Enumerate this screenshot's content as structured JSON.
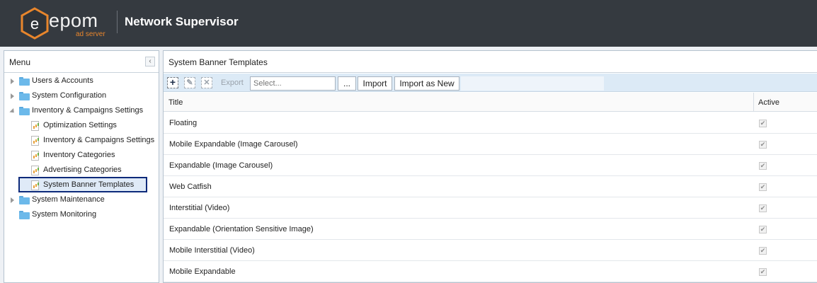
{
  "header": {
    "brand": "epom",
    "brand_sub": "ad server",
    "logo_letter": "e",
    "app_title": "Network Supervisor"
  },
  "menu": {
    "title": "Menu",
    "collapse_glyph": "‹",
    "items": [
      {
        "label": "Users & Accounts",
        "type": "folder",
        "state": "collapsed"
      },
      {
        "label": "System Configuration",
        "type": "folder",
        "state": "collapsed"
      },
      {
        "label": "Inventory & Campaigns Settings",
        "type": "folder",
        "state": "expanded"
      },
      {
        "label": "Optimization Settings",
        "type": "page"
      },
      {
        "label": "Inventory & Campaigns Settings",
        "type": "page"
      },
      {
        "label": "Inventory Categories",
        "type": "page"
      },
      {
        "label": "Advertising Categories",
        "type": "page"
      },
      {
        "label": "System Banner Templates",
        "type": "page",
        "selected": true
      },
      {
        "label": "System Maintenance",
        "type": "folder",
        "state": "collapsed"
      },
      {
        "label": "System Monitoring",
        "type": "folder",
        "state": "none"
      }
    ]
  },
  "panel": {
    "title": "System Banner Templates",
    "toolbar": {
      "add_glyph": "+",
      "edit_glyph": "✎",
      "delete_glyph": "✕",
      "export_label": "Export",
      "select_placeholder": "Select...",
      "browse_label": "...",
      "import_label": "Import",
      "import_new_label": "Import as New"
    },
    "columns": {
      "title": "Title",
      "active": "Active"
    },
    "rows": [
      {
        "title": "Floating",
        "active": true
      },
      {
        "title": "Mobile Expandable (Image Carousel)",
        "active": true
      },
      {
        "title": "Expandable (Image Carousel)",
        "active": true
      },
      {
        "title": "Web Catfish",
        "active": true
      },
      {
        "title": "Interstitial (Video)",
        "active": true
      },
      {
        "title": "Expandable (Orientation Sensitive Image)",
        "active": true
      },
      {
        "title": "Mobile Interstitial (Video)",
        "active": true
      },
      {
        "title": "Mobile Expandable",
        "active": true
      }
    ],
    "check_glyph": "✔"
  },
  "colors": {
    "topbar": "#353a40",
    "accent_orange": "#e8862c",
    "selection_border": "#0d2a7a",
    "toolbar_bg": "#dceaf6",
    "folder": "#6cb9ea"
  }
}
